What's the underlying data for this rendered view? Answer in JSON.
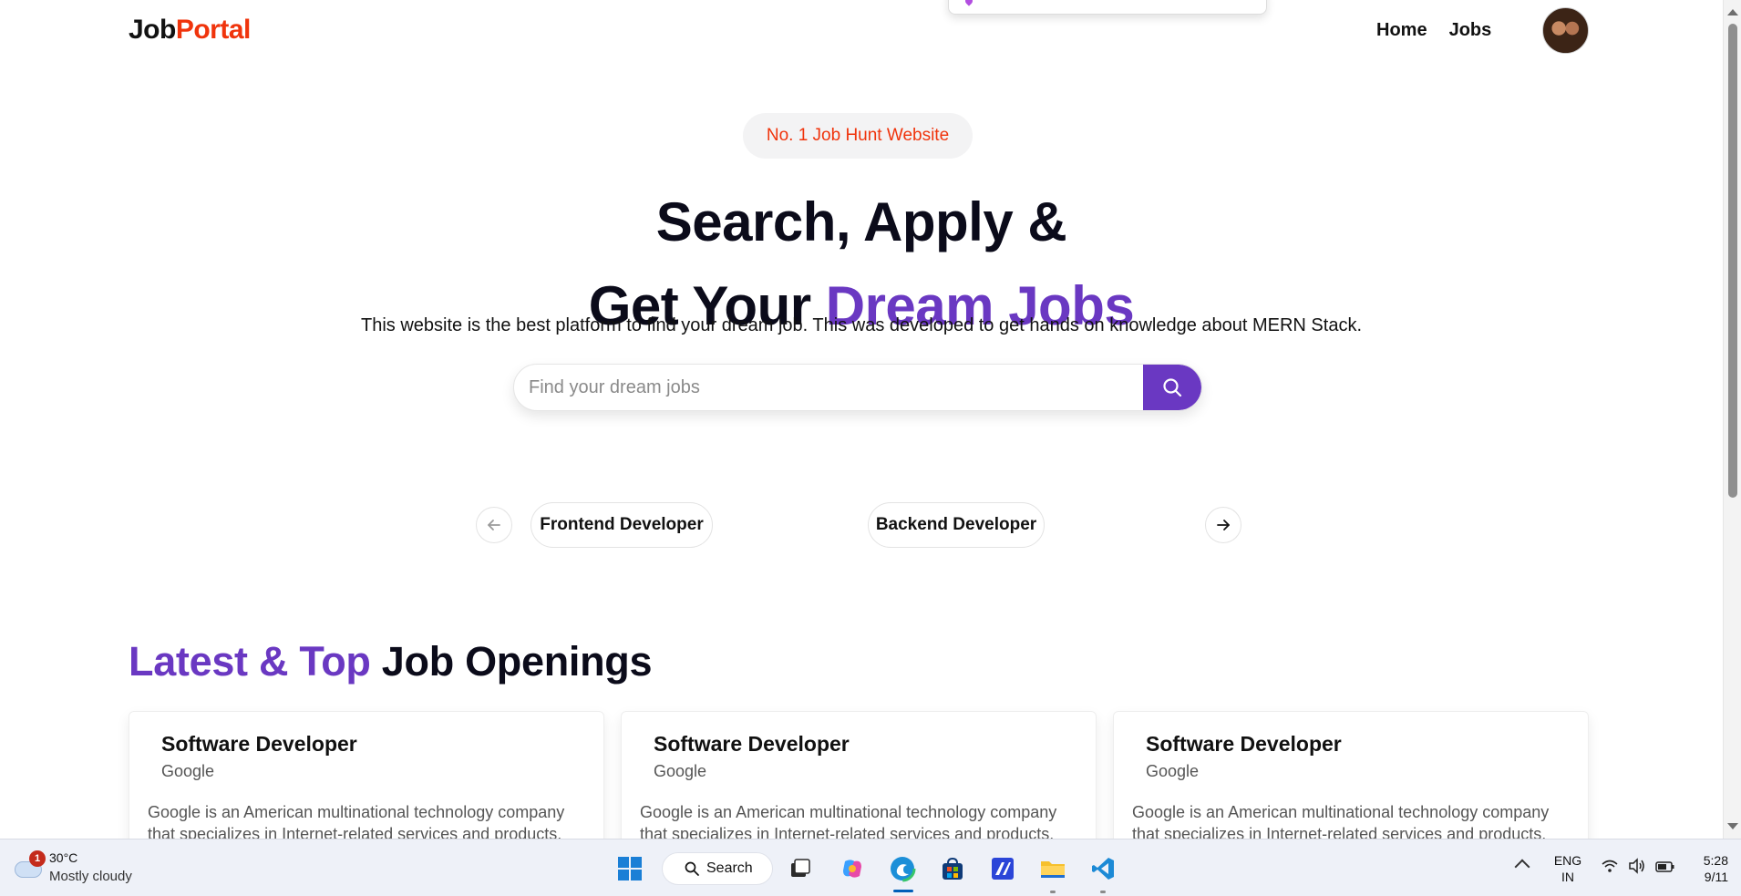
{
  "nav": {
    "logo_part1": "Job",
    "logo_part2": "Portal",
    "links": [
      "Home",
      "Jobs"
    ]
  },
  "hero": {
    "badge": "No. 1 Job Hunt Website",
    "title_line1": "Search, Apply &",
    "title_line2_plain": "Get Your ",
    "title_line2_accent": "Dream Jobs",
    "subtitle": "This website is the best platform to find your dream job. This was developed to get hands on knowledge about MERN Stack.",
    "search_placeholder": "Find your dream jobs",
    "search_value": ""
  },
  "carousel": {
    "items": [
      "Frontend Developer",
      "Backend Developer"
    ]
  },
  "latest": {
    "title_accent": "Latest & Top",
    "title_plain": " Job Openings",
    "cards": [
      {
        "role": "Software Developer",
        "company": "Google",
        "description": "Google is an American multinational technology company that specializes in Internet-related services and products."
      },
      {
        "role": "Software Developer",
        "company": "Google",
        "description": "Google is an American multinational technology company that specializes in Internet-related services and products."
      },
      {
        "role": "Software Developer",
        "company": "Google",
        "description": "Google is an American multinational technology company that specializes in Internet-related services and products."
      }
    ]
  },
  "taskbar": {
    "weather_temp": "30°C",
    "weather_condition": "Mostly cloudy",
    "weather_alert_count": "1",
    "search_label": "Search",
    "lang_line1": "ENG",
    "lang_line2": "IN",
    "time": "5:28",
    "date": "9/11",
    "apps": [
      "start-icon",
      "task-view-icon",
      "copilot-icon",
      "edge-icon",
      "store-icon",
      "app-icon",
      "file-explorer-icon",
      "vscode-icon"
    ]
  },
  "colors": {
    "accent_purple": "#6a38c2",
    "accent_red": "#f0340c",
    "text_dark": "#0b0b1a"
  }
}
